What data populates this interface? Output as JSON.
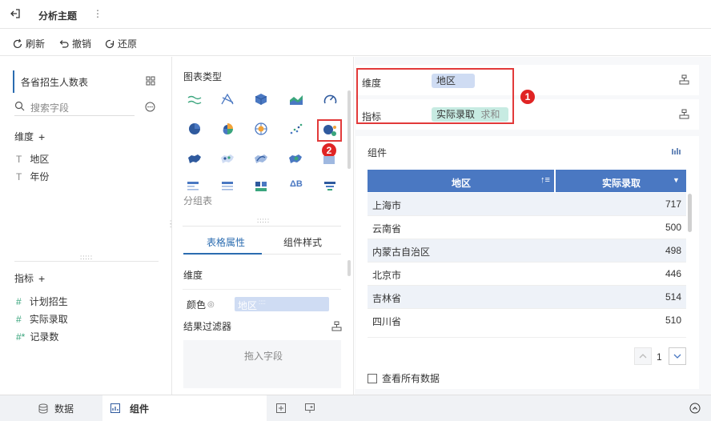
{
  "topbar": {
    "back_icon": "back-icon",
    "title": "分析主题",
    "more": "⋮"
  },
  "toolbar": {
    "refresh": "刷新",
    "undo": "撤销",
    "redo": "还原"
  },
  "left": {
    "dataset": "各省招生人数表",
    "search_placeholder": "搜索字段",
    "dimension_label": "维度",
    "dimension_fields": [
      "地区",
      "年份"
    ],
    "metric_label": "指标",
    "metric_fields": [
      "计划招生",
      "实际录取",
      "记录数"
    ]
  },
  "mid": {
    "chart_type_label": "图表类型",
    "group_table_label": "分组表",
    "tab_props": "表格属性",
    "tab_style": "组件样式",
    "dimension_label": "维度",
    "color_label": "颜色",
    "color_chip": "地区",
    "filter_label": "结果过滤器",
    "drop_hint": "拖入字段"
  },
  "right": {
    "dim_label": "维度",
    "dim_chip": "地区",
    "metric_label": "指标",
    "metric_chip": "实际录取",
    "metric_agg": "求和",
    "badge1": "1",
    "badge2": "2",
    "component_label": "组件",
    "table": {
      "headers": [
        "地区",
        "实际录取"
      ],
      "rows": [
        [
          "上海市",
          "717"
        ],
        [
          "云南省",
          "500"
        ],
        [
          "内蒙古自治区",
          "498"
        ],
        [
          "北京市",
          "446"
        ],
        [
          "吉林省",
          "514"
        ],
        [
          "四川省",
          "510"
        ]
      ]
    },
    "page_num": "1",
    "view_all": "查看所有数据"
  },
  "bottom": {
    "tab_data": "数据",
    "tab_component": "组件"
  },
  "colors": {
    "accent": "#2b6cb0",
    "header_blue": "#4a78c2",
    "chip_blue": "#cfdcf3",
    "chip_green": "#c7ebe2",
    "row_alt": "#eef2f8",
    "red": "#e02424"
  }
}
